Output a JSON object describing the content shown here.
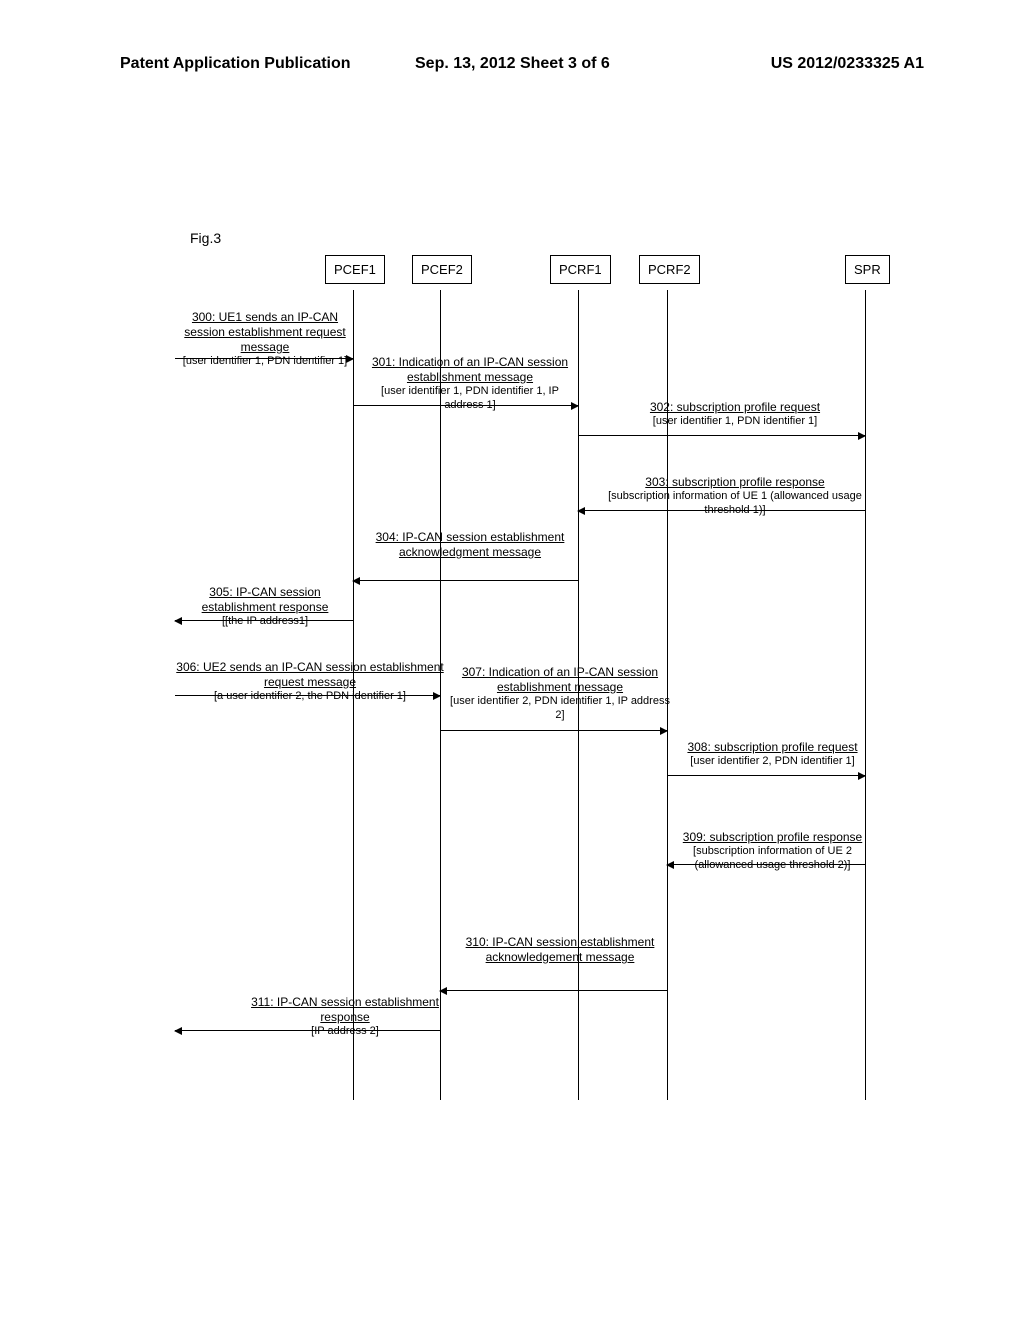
{
  "header": {
    "left": "Patent Application Publication",
    "center": "Sep. 13, 2012  Sheet 3 of 6",
    "right": "US 2012/0233325 A1"
  },
  "figure_label": "Fig.3",
  "entities": {
    "pcef1": "PCEF1",
    "pcef2": "PCEF2",
    "pcrf1": "PCRF1",
    "pcrf2": "PCRF2",
    "spr": "SPR"
  },
  "messages": {
    "s300": {
      "label": "300: UE1 sends an IP-CAN session establishment request message",
      "sub": "[user identifier 1, PDN identifier 1]"
    },
    "s301": {
      "label": "301: Indication of an IP-CAN session establishment  message",
      "sub": "[user identifier 1, PDN identifier 1, IP address 1]"
    },
    "s302": {
      "label": "302: subscription profile request",
      "sub": "[user identifier 1, PDN identifier 1]"
    },
    "s303": {
      "label": "303: subscription profile response",
      "sub": "[subscription information of UE 1 (allowanced usage threshold 1)]"
    },
    "s304": {
      "label": "304: IP-CAN session establishment acknowledgment message"
    },
    "s305": {
      "label": "305: IP-CAN session establishment response",
      "sub": "[[the IP address1]"
    },
    "s306": {
      "label": "306: UE2 sends an IP-CAN session establishment request message",
      "sub": "[a user identifier 2, the PDN identifier 1]"
    },
    "s307": {
      "label": "307: Indication of an IP-CAN session establishment message",
      "sub": "[user identifier 2, PDN identifier 1, IP address 2]"
    },
    "s308": {
      "label": "308: subscription profile request",
      "sub": "[user identifier 2, PDN identifier 1]"
    },
    "s309": {
      "label": "309: subscription profile response",
      "sub": "[subscription information of UE 2 (allowanced usage threshold 2)]"
    },
    "s310": {
      "label": "310: IP-CAN session establishment acknowledgement message"
    },
    "s311": {
      "label": "311: IP-CAN session establishment response",
      "sub": "[IP address 2]"
    }
  }
}
